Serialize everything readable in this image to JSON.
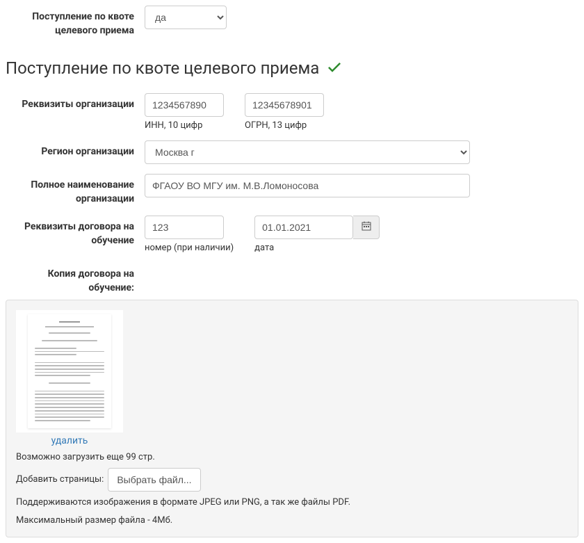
{
  "top": {
    "quota_label": "Поступление по квоте целевого приема",
    "quota_value": "да"
  },
  "section": {
    "title": "Поступление по квоте целевого приема"
  },
  "org_req": {
    "label": "Реквизиты организации",
    "inn_value": "1234567890",
    "inn_help": "ИНН, 10 цифр",
    "ogrn_value": "12345678901",
    "ogrn_help": "ОГРН, 13 цифр"
  },
  "region": {
    "label": "Регион организации",
    "value": "Москва г"
  },
  "org_name": {
    "label": "Полное наименование организации",
    "value": "ФГАОУ ВО МГУ им. М.В.Ломоносова"
  },
  "contract": {
    "label": "Реквизиты договора на обучение",
    "num_value": "123",
    "num_help": "номер (при наличии)",
    "date_value": "01.01.2021",
    "date_help": "дата"
  },
  "contract_copy": {
    "label": "Копия договора на обучение:"
  },
  "upload": {
    "delete": "удалить",
    "remaining": "Возможно загрузить еще 99 стр.",
    "add_label": "Добавить страницы:",
    "choose_file": "Выбрать файл...",
    "formats": "Поддерживаются изображения в формате JPEG или PNG, а так же файлы PDF.",
    "maxsize": "Максимальный размер файла - 4Мб."
  }
}
